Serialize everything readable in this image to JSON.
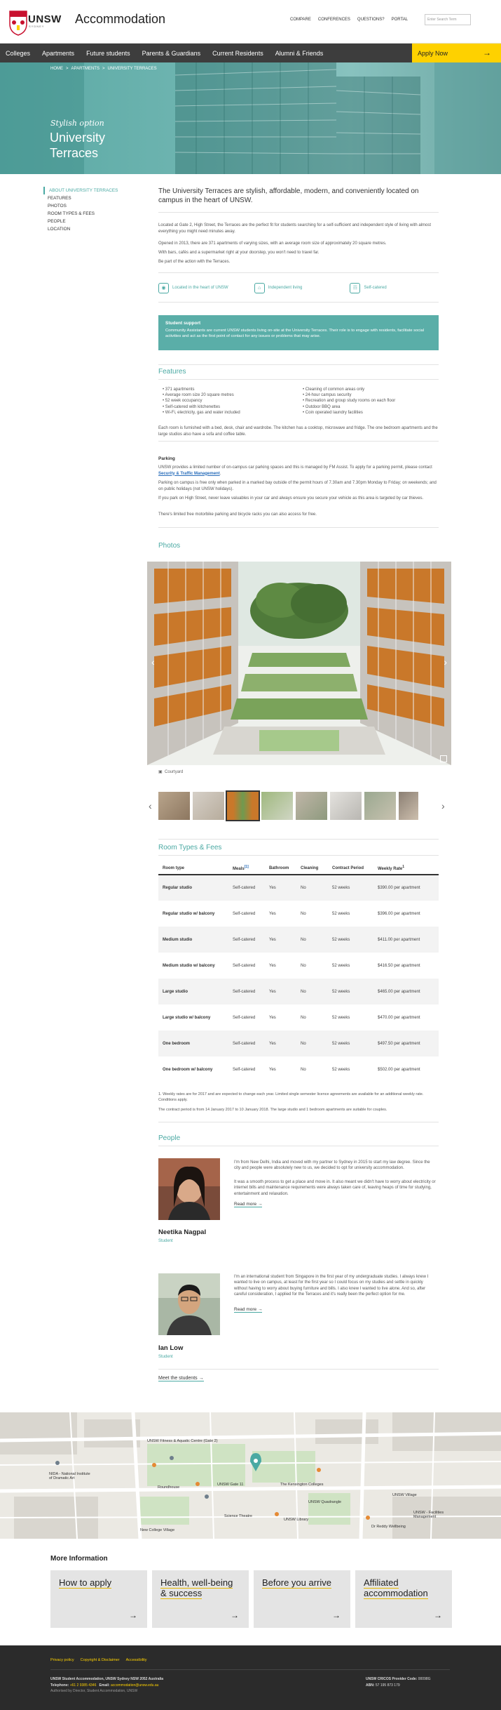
{
  "header": {
    "logo_text": "UNSW",
    "logo_sub": "SYDNEY",
    "site_title": "Accommodation",
    "utility": [
      "COMPARE",
      "CONFERENCES",
      "QUESTIONS?",
      "PORTAL"
    ],
    "search_placeholder": "Enter Search Term"
  },
  "nav": {
    "items": [
      "Colleges",
      "Apartments",
      "Future students",
      "Parents & Guardians",
      "Current Residents",
      "Alumni & Friends"
    ],
    "apply_label": "Apply Now"
  },
  "hero": {
    "breadcrumb": [
      "HOME",
      "APARTMENTS",
      "UNIVERSITY TERRACES"
    ],
    "tagline": "Stylish option",
    "title": "University Terraces"
  },
  "sidebar": [
    "ABOUT UNIVERSITY TERRACES",
    "FEATURES",
    "PHOTOS",
    "ROOM TYPES & FEES",
    "PEOPLE",
    "LOCATION"
  ],
  "intro": {
    "lead": "The University Terraces are stylish, affordable, modern, and conveniently located on campus in the heart of UNSW.",
    "p1": "Located at Gate 2, High Street, the Terraces are the perfect fit for students searching for a self-sufficient and independent style of living with almost everything you might need minutes away.",
    "p2": "Opened in 2013, there are 371 apartments of varying sizes, with an average room size of approximately 20 square metres.",
    "p3": "With bars, cafés and a supermarket right at your doorstep, you won't need to travel far.",
    "p4": "Be part of the action with the Terraces."
  },
  "chips": [
    "Located in the heart of UNSW",
    "Independent living",
    "Self-catered"
  ],
  "support": {
    "heading": "Student support",
    "body": "Community Assistants are current UNSW students living on-site at the University Terraces. Their role is to engage with residents, facilitate social activities and act as the first point of contact for any issues or problems that may arise."
  },
  "features": {
    "heading": "Features",
    "left": [
      "371 apartments",
      "Average room size 20 square metres",
      "52 week occupancy",
      "Self-catered with kitchenettes",
      "Wi-Fi, electricity, gas and water included"
    ],
    "right": [
      "Cleaning of common areas only",
      "24-hour campus security",
      "Recreation and group study rooms on each floor",
      "Outdoor BBQ area",
      "Coin operated laundry facilities"
    ],
    "note": "Each room is furnished with a bed, desk, chair and wardrobe. The kitchen has a cooktop, microwave and fridge. The one bedroom apartments and the large studios also have a sofa and coffee table."
  },
  "parking": {
    "heading": "Parking",
    "p1a": "UNSW provides a limited number of on-campus car parking spaces and this is managed by FM Assist. To apply for a parking permit, please contact ",
    "p1_link": "Security & Traffic Management",
    "p1b": ".",
    "p2": "Parking on campus is free only when parked in a marked bay outside of the permit hours of 7.30am and 7.30pm Monday to Friday; on weekends; and on public holidays (not UNSW holidays).",
    "p3": "If you park on High Street, never leave valuables in your car and always ensure you secure your vehicle as this area is targeted by car thieves.",
    "p4": "There's limited free motorbike parking and bicycle racks you can also access for free."
  },
  "photos": {
    "heading": "Photos",
    "caption": "Courtyard"
  },
  "fees": {
    "heading": "Room Types & Fees",
    "columns": [
      "Room type",
      "Meals",
      "Bathroom",
      "Cleaning",
      "Contract Period",
      "Weekly Rate"
    ],
    "meals_sup": "[1]",
    "rate_sup": "1",
    "rows": [
      [
        "Regular studio",
        "Self-catered",
        "Yes",
        "No",
        "52 weeks",
        "$390.00 per apartment"
      ],
      [
        "Regular studio w/ balcony",
        "Self-catered",
        "Yes",
        "No",
        "52 weeks",
        "$396.00 per apartment"
      ],
      [
        "Medium studio",
        "Self-catered",
        "Yes",
        "No",
        "52 weeks",
        "$411.00 per apartment"
      ],
      [
        "Medium studio w/ balcony",
        "Self-catered",
        "Yes",
        "No",
        "52 weeks",
        "$416.50 per apartment"
      ],
      [
        "Large studio",
        "Self-catered",
        "Yes",
        "No",
        "52 weeks",
        "$465.00 per apartment"
      ],
      [
        "Large studio w/ balcony",
        "Self-catered",
        "Yes",
        "No",
        "52 weeks",
        "$470.00 per apartment"
      ],
      [
        "One bedroom",
        "Self-catered",
        "Yes",
        "No",
        "52 weeks",
        "$497.50 per apartment"
      ],
      [
        "One bedroom w/ balcony",
        "Self-catered",
        "Yes",
        "No",
        "52 weeks",
        "$502.00 per apartment"
      ]
    ],
    "footnote": "1. Weekly rates are for 2017 and are expected to change each year. Limited single semester licence agreements are available for an additional weekly rate. Conditions apply.",
    "contract_note": "The contract period is from 14 January 2017 to 10 January 2018. The large studio and 1 bedroom apartments are suitable for couples."
  },
  "people": {
    "heading": "People",
    "p1": {
      "name": "Neetika Nagpal",
      "role": "Student",
      "bio1": "I'm from New Delhi, India and moved with my partner to Sydney in 2015 to start my law degree. Since the city and people were absolutely new to us, we decided to opt for university accommodation.",
      "bio2": "It was a smooth process to get a place and move in. It also meant we didn't have to worry about electricity or internet bills and maintenance requirements were always taken care of, leaving heaps of time for studying, entertainment and relaxation.",
      "read": "Read more"
    },
    "p2": {
      "name": "Ian Low",
      "role": "Student",
      "bio1": "I'm an international student from Singapore in the first year of my undergraduate studies. I always knew I wanted to live on campus, at least for the first year so I could focus on my studies and settle in quickly without having to worry about buying furniture and bills. I also knew I wanted to live alone. And so, after careful consideration, I applied for the Terraces and it's really been the perfect option for me.",
      "read": "Read more"
    },
    "meet": "Meet the students"
  },
  "map": {
    "labels": [
      "UNSW Fitness & Aquatic Centre (Gate 2)",
      "NIDA - National Institute of Dramatic Art",
      "Roundhouse",
      "UNSW Gate 11",
      "The Kensington Colleges",
      "UNSW Quadrangle",
      "UNSW Village",
      "Science Theatre",
      "UNSW Library",
      "UNSW - Facilities Management",
      "New College Village",
      "Dr Reddy Wellbeing"
    ]
  },
  "more": {
    "heading": "More Information",
    "cards": [
      "How to apply",
      "Health, well-being & success",
      "Before you arrive",
      "Affiliated accommodation"
    ]
  },
  "footer": {
    "links": [
      "Privacy policy",
      "Copyright & Disclaimer",
      "Accessibility"
    ],
    "addr": "UNSW Student Accommodation, UNSW Sydney NSW 2052 Australia",
    "tel_label": "Telephone:",
    "tel": "+61 2 9385 4346",
    "email_label": "Email:",
    "email": "accommodation@unsw.edu.au",
    "auth": "Authorised by Director, Student Accommodation, UNSW",
    "cricos_label": "UNSW CRICOS Provider Code:",
    "cricos": "00098G",
    "abn_label": "ABN:",
    "abn": "57 195 873 179"
  },
  "colors": {
    "teal": "#4aa9a3",
    "yellow": "#fed100",
    "nav_bg": "#3d3d3d",
    "footer_bg": "#2b2b2b"
  }
}
